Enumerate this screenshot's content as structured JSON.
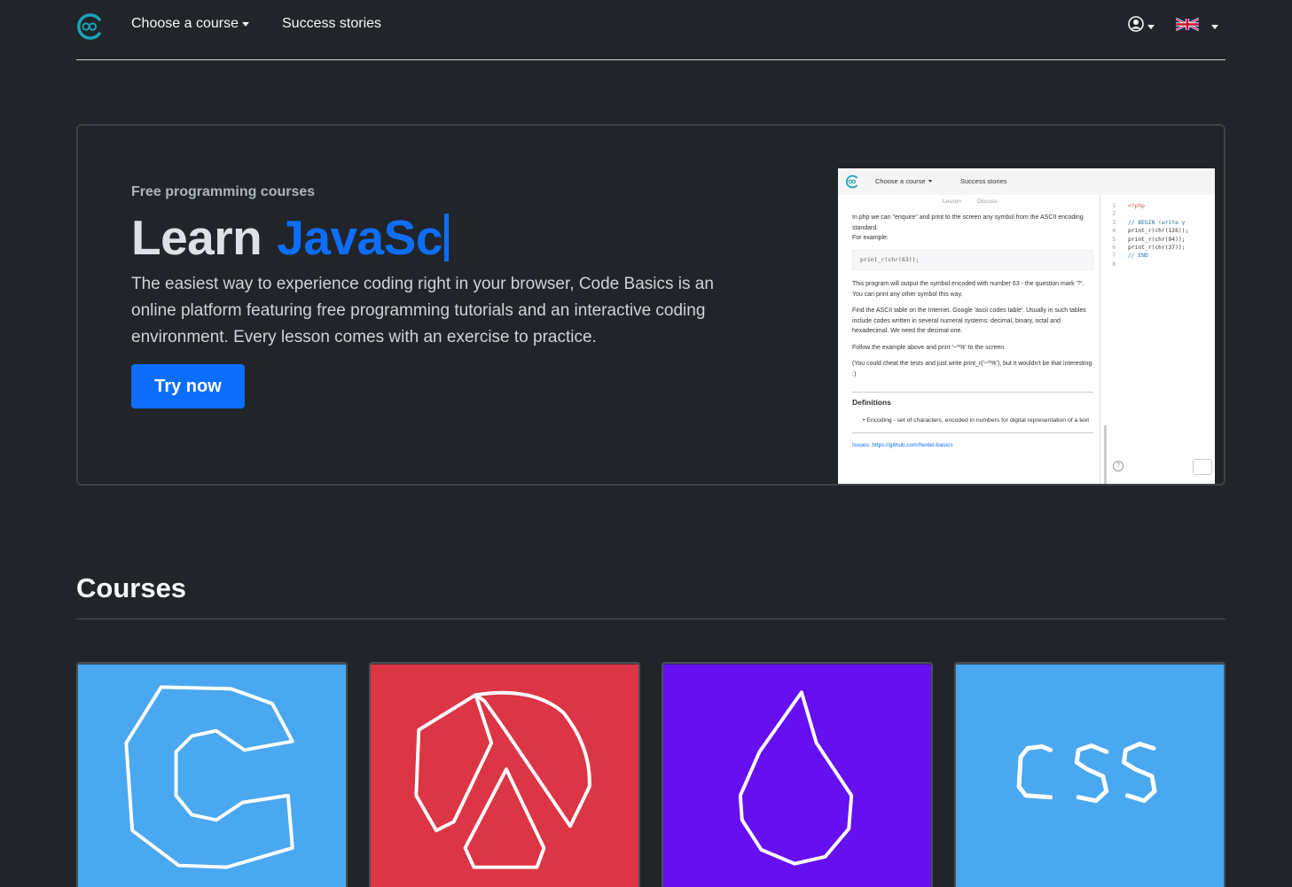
{
  "nav": {
    "logo_icon": "code-basics-logo-icon",
    "choose_course_label": "Choose a course",
    "success_stories_label": "Success stories",
    "user_icon": "user-circle-icon",
    "language_icon": "uk-flag-icon"
  },
  "hero": {
    "subtitle": "Free programming courses",
    "title_prefix": "Learn",
    "title_highlight": "JavaSc",
    "description": "The easiest way to experience coding right in your browser, Code Basics is an online platform featuring free programming tutorials and an interactive coding environment. Every lesson comes with an exercise to practice.",
    "button_label": "Try now",
    "accent_color": "#0d6efd"
  },
  "preview": {
    "nav_course": "Choose a course",
    "nav_success": "Success stories",
    "tab_lesson": "Lesson",
    "tab_discuss": "Discuss",
    "p1": "In php we can \"enquire\" and print to the screen any symbol from the ASCII encoding standard.",
    "p1b": "For example:",
    "code_example": "print_r(chr(63));",
    "p2": "This program will output the symbol encoded with number 63 - the question mark '?'. You can print any other symbol this way.",
    "p3": "Find the ASCII table on the Internet. Google 'ascii codes table'. Usually in such tables include codes written in several numeral systems: decimal, binary, octal and hexadecimal. We need the decimal one.",
    "p4": "Follow the example above and print '~^%' to the screen.",
    "p5": "(You could cheat the tests and just write print_r('~^%'), but it wouldn't be that interesting :)",
    "definitions_title": "Definitions",
    "definition_1": "Encoding - set of characters, encoded in numbers for digital representation of a text",
    "issues_link": "Issues: https://github.com/hexlet-basics",
    "editor_lines": [
      {
        "num": "1",
        "code": "<?php"
      },
      {
        "num": "2",
        "code": ""
      },
      {
        "num": "3",
        "code": "// BEGIN (write y"
      },
      {
        "num": "4",
        "code": "print_r(chr(126));"
      },
      {
        "num": "5",
        "code": "print_r(chr(94));"
      },
      {
        "num": "6",
        "code": "print_r(chr(37));"
      },
      {
        "num": "7",
        "code": "// END"
      },
      {
        "num": "8",
        "code": ""
      }
    ]
  },
  "courses": {
    "title": "Courses",
    "cards": [
      {
        "icon": "c-language-icon",
        "color": "#4aa8f0"
      },
      {
        "icon": "scheme-lambda-icon",
        "color": "#dc3545"
      },
      {
        "icon": "elixir-drop-icon",
        "color": "#6610f2"
      },
      {
        "icon": "css-icon",
        "color": "#4aa8f0"
      }
    ]
  }
}
